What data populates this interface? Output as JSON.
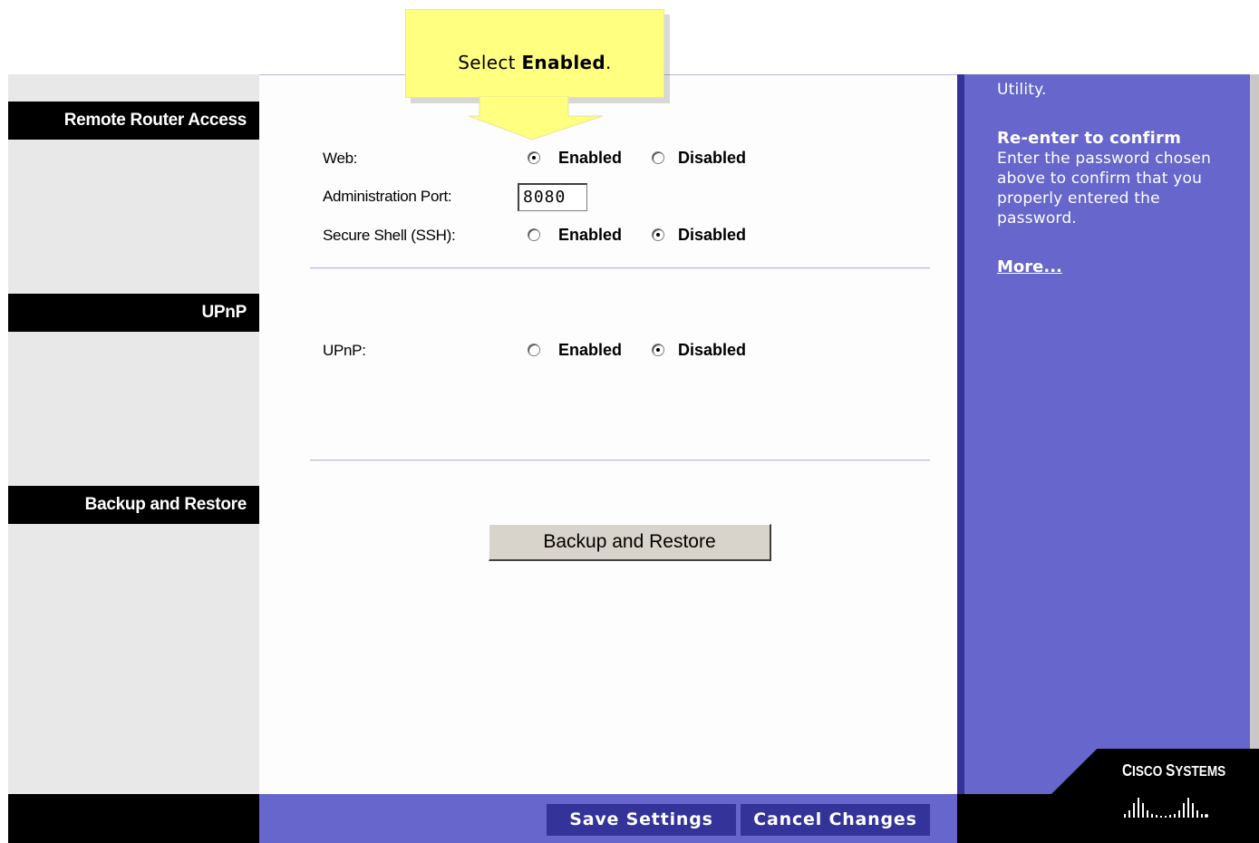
{
  "sidebar": {
    "sections": [
      {
        "label": "Remote Router Access"
      },
      {
        "label": "UPnP"
      },
      {
        "label": "Backup and Restore"
      }
    ]
  },
  "remote_access": {
    "web_label": "Web:",
    "web_enabled": "Enabled",
    "web_disabled": "Disabled",
    "web_selected": "Enabled",
    "port_label": "Administration Port:",
    "port_value": "8080",
    "ssh_label": "Secure Shell (SSH):",
    "ssh_enabled": "Enabled",
    "ssh_disabled": "Disabled",
    "ssh_selected": "Disabled"
  },
  "upnp": {
    "label": "UPnP:",
    "enabled": "Enabled",
    "disabled": "Disabled",
    "selected": "Disabled"
  },
  "backup": {
    "button_label": "Backup and Restore"
  },
  "footer": {
    "save_label": "Save Settings",
    "cancel_label": "Cancel Changes"
  },
  "help": {
    "partial_line": "Utility.",
    "heading": "Re-enter to confirm",
    "lines": [
      "Enter the password chosen",
      "above to confirm that you",
      "properly entered the",
      "password."
    ],
    "more_link": "More..."
  },
  "brand": {
    "name": "Cisco Systems",
    "logo_icon": "cisco-bridge-logo"
  },
  "callout": {
    "prefix": "Select",
    "emphasis": "Enabled",
    "suffix": "."
  },
  "colors": {
    "accent_blue": "#6666cc",
    "dark_blue": "#333399",
    "callout_yellow": "#ffff80"
  }
}
